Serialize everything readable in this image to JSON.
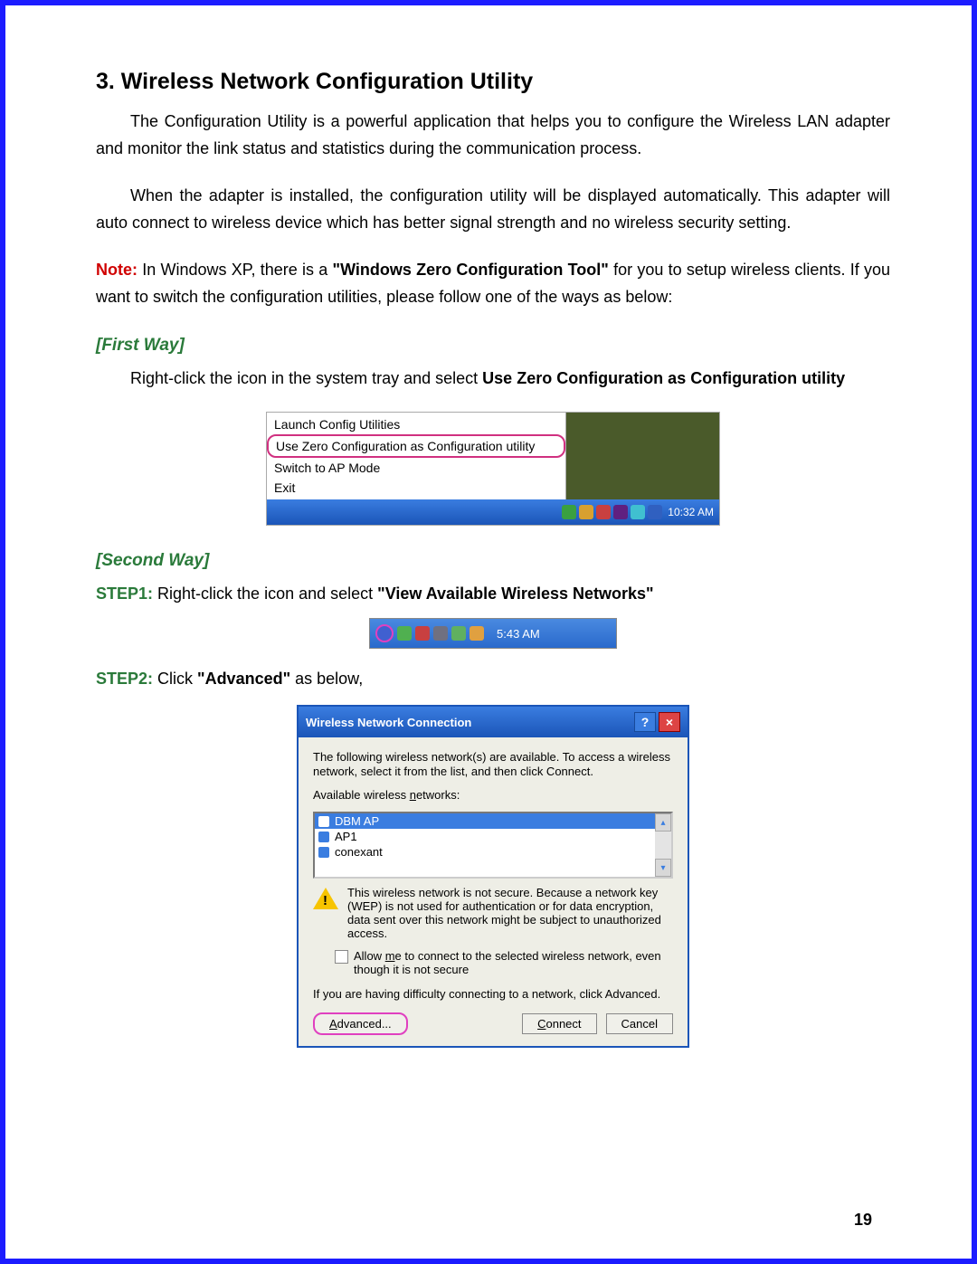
{
  "heading": "3. Wireless Network Configuration Utility",
  "p1": "The Configuration Utility is a powerful application that helps you to configure the Wireless LAN adapter and monitor the link status and statistics during the communication process.",
  "p2": "When the adapter is installed, the configuration utility will be displayed automatically. This adapter will auto connect to wireless device which has better signal strength and no wireless security setting.",
  "noteLabel": "Note:",
  "p3a": " In Windows XP, there is a ",
  "p3bold": "\"Windows Zero Configuration Tool\"",
  "p3b": " for you to setup wireless clients. If you want to switch the configuration utilities, please follow one of the ways as below:",
  "firstWay": "[First Way]",
  "firstWayText1": "Right-click the icon in the system tray and select ",
  "firstWayBold": "Use Zero Configuration as Configuration utility",
  "menu": {
    "i1": "Launch Config Utilities",
    "i2": "Use Zero Configuration as Configuration utility",
    "i3": "Switch to AP Mode",
    "i4": "Exit"
  },
  "clock1": "10:32 AM",
  "secondWay": "[Second Way]",
  "step1Label": "STEP1:",
  "step1Text": " Right-click the icon and select ",
  "step1Bold": "\"View Available Wireless Networks\"",
  "clock2": "5:43 AM",
  "step2Label": "STEP2:",
  "step2Text": " Click ",
  "step2Bold": "\"Advanced\"",
  "step2Text2": " as below,",
  "dlg": {
    "title": "Wireless Network Connection",
    "intro": "The following wireless network(s) are available. To access a wireless network, select it from the list, and then click Connect.",
    "listLabel": "Available wireless networks:",
    "items": [
      "DBM AP",
      "AP1",
      "conexant"
    ],
    "warn": "This wireless network is not secure. Because a network key (WEP) is not used for authentication or for data encryption, data sent over this network might be subject to unauthorized access.",
    "chkText": "Allow me to connect to the selected wireless network, even though it is not secure",
    "trouble": "If you are having difficulty connecting to a network, click Advanced.",
    "btnAdvanced": "Advanced...",
    "btnConnect": "Connect",
    "btnCancel": "Cancel"
  },
  "pageNumber": "19",
  "trayColors1": [
    "#3aa040",
    "#d8a030",
    "#c84040",
    "#602080",
    "#40c0d0",
    "#3060c0"
  ],
  "trayColors2": [
    "#4060d0",
    "#50b050",
    "#c84040",
    "#707080",
    "#60b060",
    "#e0a040"
  ]
}
